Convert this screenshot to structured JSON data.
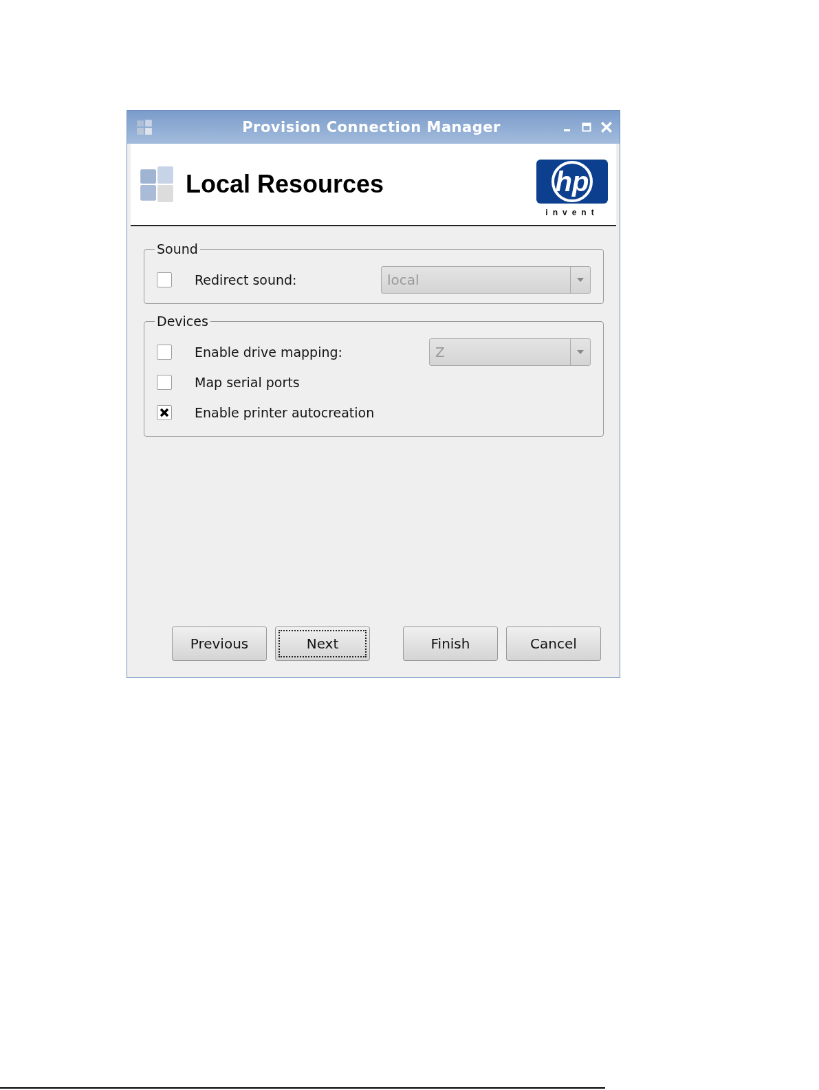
{
  "window": {
    "title": "Provision Connection Manager"
  },
  "header": {
    "title": "Local Resources",
    "logo": {
      "mark": "hp",
      "tagline": "invent"
    }
  },
  "groups": [
    {
      "title": "Sound",
      "rows": [
        {
          "label": "Redirect sound:",
          "checked": false,
          "combo": {
            "value": "local",
            "disabled": true
          }
        }
      ]
    },
    {
      "title": "Devices",
      "rows": [
        {
          "label": "Enable drive mapping:",
          "checked": false,
          "combo": {
            "value": "Z",
            "disabled": true
          }
        },
        {
          "label": "Map serial ports",
          "checked": false
        },
        {
          "label": "Enable printer autocreation",
          "checked": true
        }
      ]
    }
  ],
  "buttons": [
    {
      "label": "Previous",
      "focused": false
    },
    {
      "label": "Next",
      "focused": true
    },
    {
      "label": "Finish",
      "focused": false
    },
    {
      "label": "Cancel",
      "focused": false
    }
  ]
}
